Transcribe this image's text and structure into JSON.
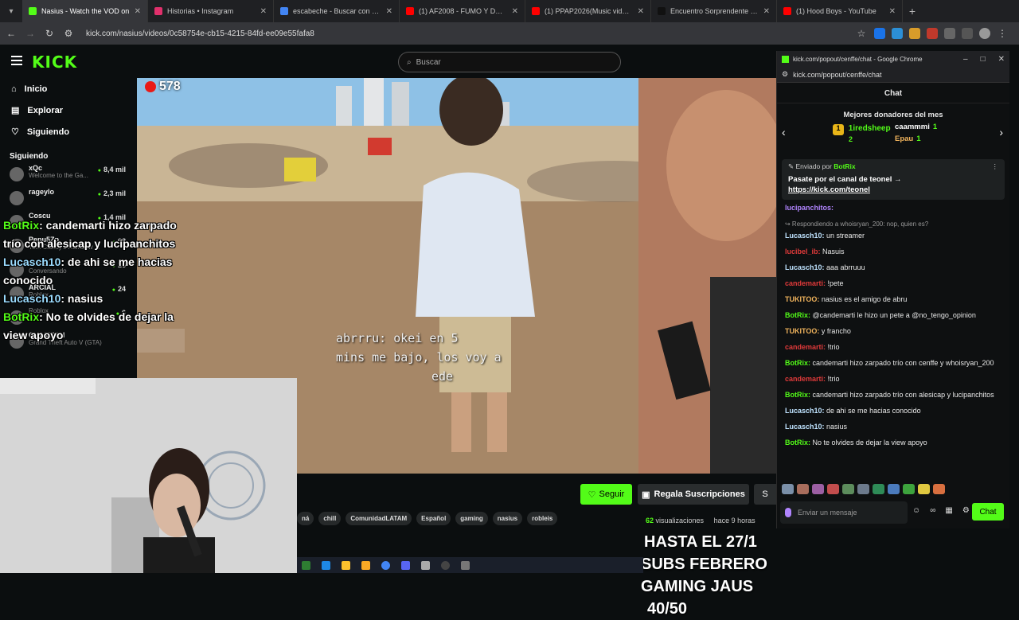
{
  "browser": {
    "tabs": [
      {
        "title": "Nasius - Watch the VOD on",
        "color": "#53fc18"
      },
      {
        "title": "Historias • Instagram",
        "color": "#e1306c"
      },
      {
        "title": "escabeche - Buscar con Google",
        "color": "#4285f4"
      },
      {
        "title": "(1) AF2008 - FUMO Y DESPUÉS",
        "color": "#ff0000"
      },
      {
        "title": "(1) PPAP2026(Music video) - Yo",
        "color": "#ff0000"
      },
      {
        "title": "Encuentro Sorprendente en un",
        "color": "#111111"
      },
      {
        "title": "(1) Hood Boys - YouTube",
        "color": "#ff0000"
      }
    ],
    "url": "kick.com/nasius/videos/0c58754e-cb15-4215-84fd-ee09e55fafa8"
  },
  "header": {
    "logo": "KICK",
    "search_placeholder": "Buscar"
  },
  "sidebar": {
    "links": [
      {
        "label": "Inicio",
        "icon": "home-icon",
        "glyph": "⌂"
      },
      {
        "label": "Explorar",
        "icon": "compass-icon",
        "glyph": "▤"
      },
      {
        "label": "Siguiendo",
        "icon": "heart-icon",
        "glyph": "♡"
      }
    ],
    "following_title": "Siguiendo",
    "following": [
      {
        "name": "xQc",
        "sub": "Welcome to the Ga...",
        "viewers": "8,4 mil"
      },
      {
        "name": "rageylo",
        "sub": "",
        "viewers": "2,3 mil"
      },
      {
        "name": "Coscu",
        "sub": "",
        "viewers": "1,4 mil"
      },
      {
        "name": "Pepu5Zp",
        "sub": "Tom Clancy's Rainbow ...",
        "viewers": "68"
      },
      {
        "name": "achie...",
        "sub": "Conversando",
        "viewers": "26"
      },
      {
        "name": "ARCIAL",
        "sub": "Roblox",
        "viewers": "24"
      },
      {
        "name": "",
        "sub": "Roblox",
        "viewers": "6"
      },
      {
        "name": "CHAMPAN",
        "sub": "Grand Theft Auto V (GTA)",
        "viewers": ""
      }
    ]
  },
  "video": {
    "viewers": "578",
    "overlay_lines": [
      "abrrru: okei en 5",
      "mins me bajo, los voy a",
      "ede"
    ]
  },
  "stream_chat": [
    {
      "user": "BotRix",
      "text": ": candemarti hizo zarpado trío con alesicap y lucipanchitos",
      "cls": "u-bot"
    },
    {
      "user": "Lucasch10",
      "text": ": de ahi se me hacias conocido",
      "cls": "u-luc"
    },
    {
      "user": "Lucasch10",
      "text": ": nasius",
      "cls": "u-luc"
    },
    {
      "user": "BotRix",
      "text": ": No te olvides de dejar la view apoyo",
      "cls": "u-bot"
    }
  ],
  "below": {
    "follow_label": "Seguir",
    "sub_label": "Regala Suscripciones",
    "s_label": "S",
    "tags": [
      "ná",
      "chill",
      "ComunidadLATAM",
      "Español",
      "gaming",
      "nasius",
      "robleis"
    ],
    "views_count": "62",
    "views_label": "visualizaciones",
    "time": "hace 9 horas",
    "banner_line1": "HASTA EL 27/1",
    "banner_line2": "SUBS FEBRERO GAMING JAUS",
    "banner_count": "40/50"
  },
  "popout": {
    "window_title": "kick.com/popout/cenffe/chat - Google Chrome",
    "url": "kick.com/popout/cenffe/chat",
    "chat_title": "Chat",
    "donors_title": "Mejores donadores del mes",
    "donor1": {
      "rank": "1",
      "name": "1iredsheep",
      "count": "2"
    },
    "donor2": {
      "name": "caammmi",
      "count": "1"
    },
    "donor3": {
      "name": "Epau",
      "count": "1"
    },
    "pinned_by_label": "Enviado por",
    "pinned_by_user": "BotRix",
    "pinned_text": "Pasate por el canal de teonel →",
    "pinned_link": "https://kick.com/teonel",
    "messages": [
      {
        "reply": "",
        "user": "lucipanchitos:",
        "text": "",
        "ucls": "c-purple"
      },
      {
        "reply": "↪ Respondiendo a whoisryan_200: nop, quien es?",
        "user": "Lucasch10:",
        "text": " un streamer",
        "ucls": "c-blue"
      },
      {
        "reply": "",
        "user": "lucibel_ib:",
        "text": " Nasuis",
        "ucls": "c-red"
      },
      {
        "reply": "",
        "user": "Lucasch10:",
        "text": " aaa abrruuu",
        "ucls": "c-blue"
      },
      {
        "reply": "",
        "user": "candemarti:",
        "text": " !pete",
        "ucls": "c-red"
      },
      {
        "reply": "",
        "user": "TUKITOO:",
        "text": " nasius es el amigo de abru",
        "ucls": "c-orange"
      },
      {
        "reply": "",
        "user": "BotRix:",
        "text": " @candemarti le hizo un pete a @no_tengo_opinion",
        "ucls": "c-green"
      },
      {
        "reply": "",
        "user": "TUKITOO:",
        "text": " y francho",
        "ucls": "c-orange"
      },
      {
        "reply": "",
        "user": "candemarti:",
        "text": " !trio",
        "ucls": "c-red"
      },
      {
        "reply": "",
        "user": "BotRix:",
        "text": " candemarti hizo zarpado trío con cenffe y whoisryan_200",
        "ucls": "c-green"
      },
      {
        "reply": "",
        "user": "candemarti:",
        "text": " !trio",
        "ucls": "c-red"
      },
      {
        "reply": "",
        "user": "BotRix:",
        "text": " candemarti hizo zarpado trío con alesicap y lucipanchitos",
        "ucls": "c-green"
      },
      {
        "reply": "",
        "user": "Lucasch10:",
        "text": " de ahi se me hacias conocido",
        "ucls": "c-blue"
      },
      {
        "reply": "",
        "user": "Lucasch10:",
        "text": " nasius",
        "ucls": "c-blue"
      },
      {
        "reply": "",
        "user": "BotRix:",
        "text": " No te olvides de dejar la view apoyo",
        "ucls": "c-green"
      }
    ],
    "input_placeholder": "Enviar un mensaje",
    "send_label": "Chat"
  }
}
